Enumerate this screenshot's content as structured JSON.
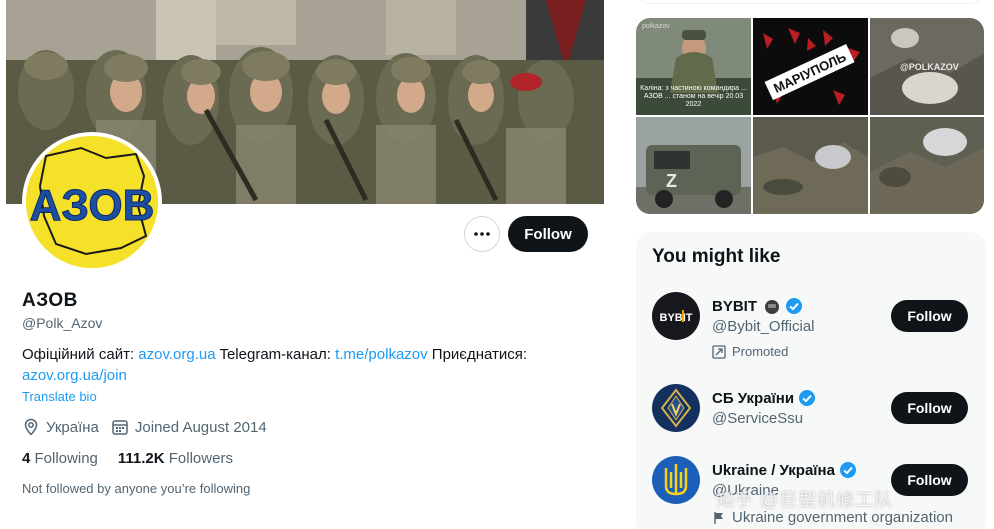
{
  "profile": {
    "display_name": "АЗОВ",
    "handle": "@Polk_Azov",
    "avatar_text": "АЗОВ",
    "bio_prefix": "Офіційний сайт: ",
    "bio_link_site": "azov.org.ua",
    "bio_telegram_label": " Telegram-канал: ",
    "bio_link_telegram": "t.me/polkazov",
    "bio_join_label": " Приєднатися: ",
    "bio_link_join": "azov.org.ua/join",
    "translate_label": "Translate bio",
    "location": "Україна",
    "joined": "Joined August 2014",
    "following_count": "4",
    "following_label": " Following",
    "followers_count": "111.2K",
    "followers_label": " Followers",
    "not_followed_text": "Not followed by anyone you’re following",
    "follow_label": "Follow",
    "more_icon": "more-horizontal-icon"
  },
  "media": {
    "tile1_caption": "Каліна: з частиною командира ... АЗОВ ... станом на вечір 20.03 2022",
    "tile1_mark": "polkazov",
    "tile2_text": "МАРІУПОЛЬ",
    "tile3_mark": "@POLKAZOV"
  },
  "who_to_follow": {
    "title": "You might like",
    "items": [
      {
        "name": "BYBIT",
        "handle": "@Bybit_Official",
        "extra": "Promoted",
        "avatar_text": "BYBIT",
        "follow_label": "Follow"
      },
      {
        "name": "СБ України",
        "handle": "@ServiceSsu",
        "extra": "",
        "follow_label": "Follow"
      },
      {
        "name": "Ukraine / Україна",
        "handle": "@Ukraine",
        "extra": "Ukraine government organization",
        "follow_label": "Follow"
      }
    ]
  },
  "watermark": "知乎 @巨型机修工队",
  "colors": {
    "accent": "#1d9bf0",
    "text": "#0f1419",
    "muted": "#536471",
    "button": "#0f1419",
    "azov_yellow": "#f6e12a",
    "azov_blue": "#1c4fa1"
  }
}
